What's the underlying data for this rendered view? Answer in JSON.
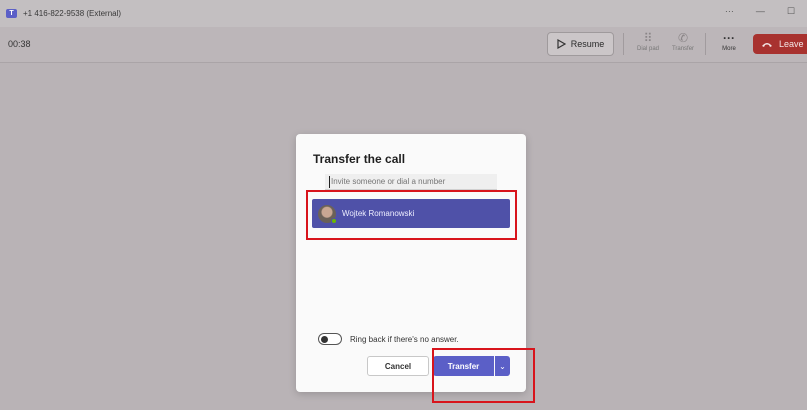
{
  "window": {
    "title": "+1 416-822-9538 (External)",
    "controls": [
      "···",
      "—",
      "☐"
    ]
  },
  "toolbar": {
    "timer": "00:38",
    "resume_label": "Resume",
    "dialpad_label": "Dial pad",
    "transfer_label": "Transfer",
    "more_label": "More",
    "leave_label": "Leave"
  },
  "dialog": {
    "title": "Transfer the call",
    "search_placeholder": "Invite someone or dial a number",
    "contact_name": "Wojtek Romanowski",
    "ringback_label": "Ring back if there's no answer.",
    "ringback_on": false,
    "cancel_label": "Cancel",
    "transfer_label": "Transfer"
  },
  "colors": {
    "accent": "#5b5fc7",
    "selected_contact": "#4f51a8",
    "leave": "#a8322f",
    "highlight": "#d8141c"
  }
}
